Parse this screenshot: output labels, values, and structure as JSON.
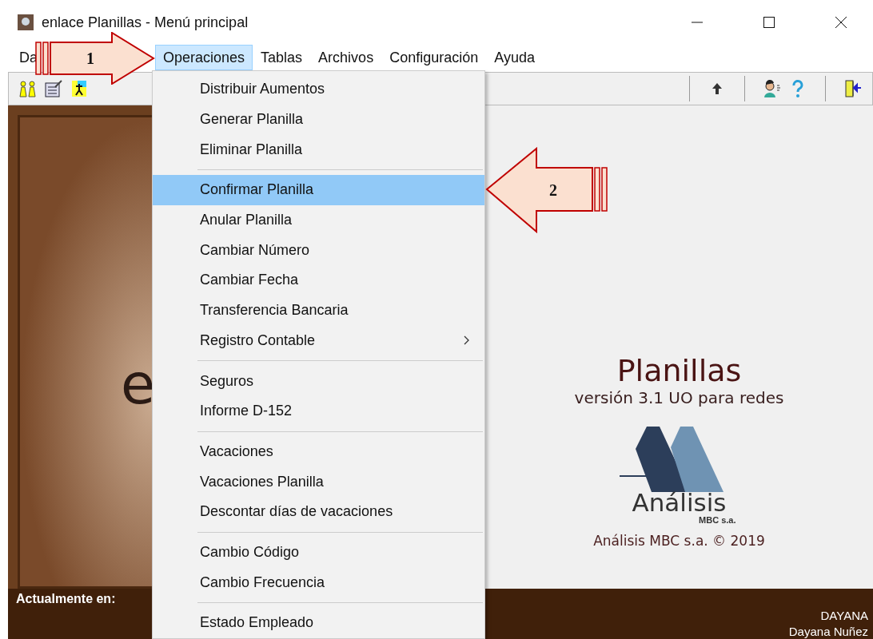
{
  "window": {
    "title": "enlace Planillas - Menú principal"
  },
  "menu_bar": [
    {
      "label": "Da",
      "selected": false
    },
    {
      "label": "Operaciones",
      "selected": true
    },
    {
      "label": "Tablas",
      "selected": false
    },
    {
      "label": "Archivos",
      "selected": false
    },
    {
      "label": "Configuración",
      "selected": false
    },
    {
      "label": "Ayuda",
      "selected": false
    }
  ],
  "dropdown": {
    "groups": [
      [
        {
          "label": "Distribuir Aumentos",
          "selected": false,
          "submenu": false
        },
        {
          "label": "Generar Planilla",
          "selected": false,
          "submenu": false
        },
        {
          "label": "Eliminar Planilla",
          "selected": false,
          "submenu": false
        }
      ],
      [
        {
          "label": "Confirmar Planilla",
          "selected": true,
          "submenu": false
        },
        {
          "label": "Anular Planilla",
          "selected": false,
          "submenu": false
        },
        {
          "label": "Cambiar Número",
          "selected": false,
          "submenu": false
        },
        {
          "label": "Cambiar Fecha",
          "selected": false,
          "submenu": false
        },
        {
          "label": "Transferencia Bancaria",
          "selected": false,
          "submenu": false
        },
        {
          "label": "Registro Contable",
          "selected": false,
          "submenu": true
        }
      ],
      [
        {
          "label": "Seguros",
          "selected": false,
          "submenu": false
        },
        {
          "label": "Informe D-152",
          "selected": false,
          "submenu": false
        }
      ],
      [
        {
          "label": "Vacaciones",
          "selected": false,
          "submenu": false
        },
        {
          "label": "Vacaciones Planilla",
          "selected": false,
          "submenu": false
        },
        {
          "label": "Descontar días de vacaciones",
          "selected": false,
          "submenu": false
        }
      ],
      [
        {
          "label": "Cambio Código",
          "selected": false,
          "submenu": false
        },
        {
          "label": "Cambio Frecuencia",
          "selected": false,
          "submenu": false
        }
      ],
      [
        {
          "label": "Estado Empleado",
          "selected": false,
          "submenu": false
        }
      ]
    ]
  },
  "splash": {
    "left_text": "e",
    "title": "Planillas",
    "subtitle": "versión 3.1 UO para redes",
    "logo_text": "Análisis",
    "logo_subtext": "MBC s.a.",
    "copyright": "Análisis MBC s.a. © 2019"
  },
  "status_bar": {
    "label": "Actualmente en:",
    "user": "DAYANA",
    "user_name": "Dayana Nuñez"
  },
  "annotations": [
    {
      "label": "1",
      "kind": "rightward"
    },
    {
      "label": "2",
      "kind": "leftward"
    }
  ]
}
